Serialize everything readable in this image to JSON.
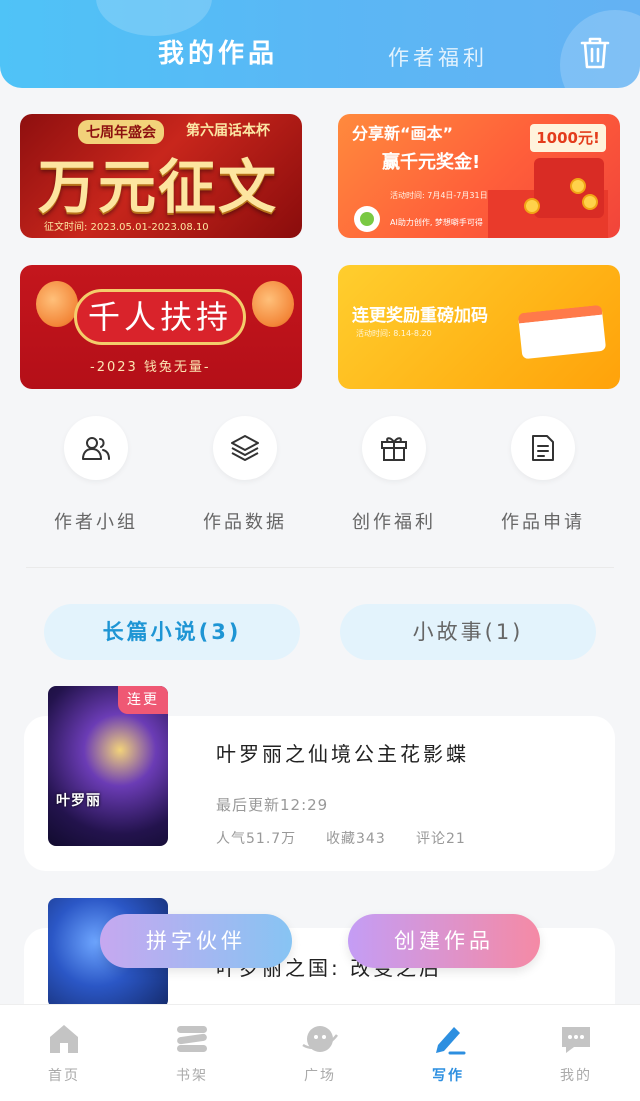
{
  "header": {
    "tab_active": "我的作品",
    "tab_inactive": "作者福利"
  },
  "banners": [
    {
      "tag": "七周年盛会",
      "subtitle": "第六届话本杯",
      "title": "万元征文",
      "date": "征文时间: 2023.05.01-2023.08.10"
    },
    {
      "line1": "分享新“画本”",
      "line2": "赢千元奖金!",
      "prize": "1000元!",
      "date": "活动时间: 7月4日-7月31日",
      "footer": "AI助力创作, 梦想噼手可得"
    },
    {
      "title": "千人扶持",
      "subtitle": "-2023 钱兔无量-"
    },
    {
      "title": "连更奖励重磅加码",
      "date": "活动时间: 8.14-8.20"
    }
  ],
  "actions": [
    {
      "label": "作者小组",
      "icon": "users-icon"
    },
    {
      "label": "作品数据",
      "icon": "layers-icon"
    },
    {
      "label": "创作福利",
      "icon": "gift-icon"
    },
    {
      "label": "作品申请",
      "icon": "document-icon"
    }
  ],
  "segments": {
    "long": "长篇小说(3)",
    "short": "小故事(1)"
  },
  "works": [
    {
      "badge": "连更",
      "cover_text": "叶罗丽",
      "title": "叶罗丽之仙境公主花影蝶",
      "update": "最后更新12:29",
      "popularity": "人气51.7万",
      "favorites": "收藏343",
      "comments": "评论21"
    },
    {
      "title": "叶罗丽之国: 改变之后"
    }
  ],
  "float_buttons": {
    "left": "拼字伙伴",
    "right": "创建作品"
  },
  "nav": [
    {
      "label": "首页",
      "icon": "home-icon"
    },
    {
      "label": "书架",
      "icon": "bookshelf-icon"
    },
    {
      "label": "广场",
      "icon": "planet-icon"
    },
    {
      "label": "写作",
      "icon": "pen-icon",
      "active": true
    },
    {
      "label": "我的",
      "icon": "chat-bubble-icon"
    }
  ],
  "colors": {
    "header_gradient": [
      "#4fc3f7",
      "#64b2f3"
    ],
    "accent_blue": "#1e95d4",
    "badge_pink": "#ef5874"
  }
}
